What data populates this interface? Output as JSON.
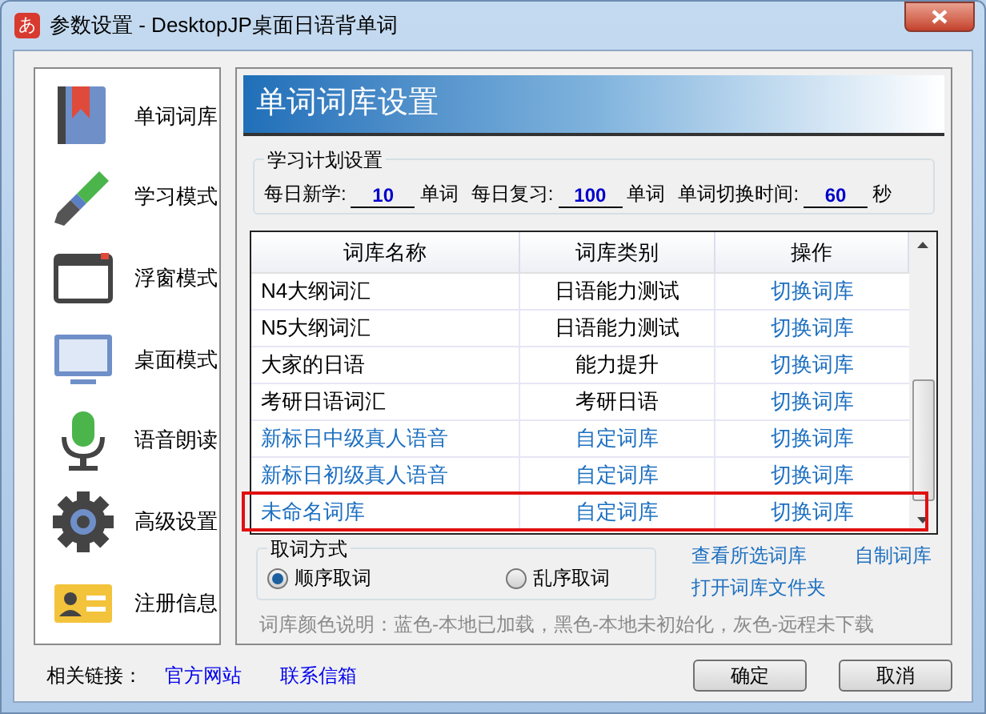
{
  "window": {
    "title": "参数设置 - DesktopJP桌面日语背单词",
    "app_icon": "あ"
  },
  "sidebar": {
    "items": [
      {
        "kind": "book",
        "label": "单词词库"
      },
      {
        "kind": "brush",
        "label": "学习模式"
      },
      {
        "kind": "window",
        "label": "浮窗模式"
      },
      {
        "kind": "monitor",
        "label": "桌面模式"
      },
      {
        "kind": "mic",
        "label": "语音朗读"
      },
      {
        "kind": "gear",
        "label": "高级设置"
      },
      {
        "kind": "card",
        "label": "注册信息"
      }
    ]
  },
  "panel": {
    "title": "单词词库设置"
  },
  "study_plan": {
    "legend": "学习计划设置",
    "fields": [
      {
        "label": "每日新学:",
        "value": "10",
        "unit": "单词"
      },
      {
        "label": "每日复习:",
        "value": "100",
        "unit": "单词"
      },
      {
        "label": "单词切换时间:",
        "value": "60",
        "unit": "秒"
      }
    ]
  },
  "table": {
    "columns": [
      "词库名称",
      "词库类别",
      "操作"
    ],
    "rows": [
      {
        "name": "N4大纲词汇",
        "category": "日语能力测试",
        "action": "切换词库",
        "color": "#000000",
        "highlighted": false
      },
      {
        "name": "N5大纲词汇",
        "category": "日语能力测试",
        "action": "切换词库",
        "color": "#000000",
        "highlighted": false
      },
      {
        "name": "大家的日语",
        "category": "能力提升",
        "action": "切换词库",
        "color": "#000000",
        "highlighted": false
      },
      {
        "name": "考研日语词汇",
        "category": "考研日语",
        "action": "切换词库",
        "color": "#000000",
        "highlighted": false
      },
      {
        "name": "新标日中级真人语音",
        "category": "自定词库",
        "action": "切换词库",
        "color": "#1c6fc0",
        "highlighted": false
      },
      {
        "name": "新标日初级真人语音",
        "category": "自定词库",
        "action": "切换词库",
        "color": "#1c6fc0",
        "highlighted": false
      },
      {
        "name": "未命名词库",
        "category": "自定词库",
        "action": "切换词库",
        "color": "#1c6fc0",
        "highlighted": true
      }
    ]
  },
  "fetch_mode": {
    "legend": "取词方式",
    "options": [
      {
        "label": "顺序取词",
        "selected": true
      },
      {
        "label": "乱序取词",
        "selected": false
      }
    ]
  },
  "links": [
    "查看所选词库",
    "自制词库",
    "打开词库文件夹"
  ],
  "legend_note": "词库颜色说明：蓝色-本地已加载，黑色-本地未初始化，灰色-远程未下载",
  "footer": {
    "label": "相关链接：",
    "links": [
      "官方网站",
      "联系信箱"
    ],
    "buttons": [
      "确定",
      "取消"
    ]
  }
}
